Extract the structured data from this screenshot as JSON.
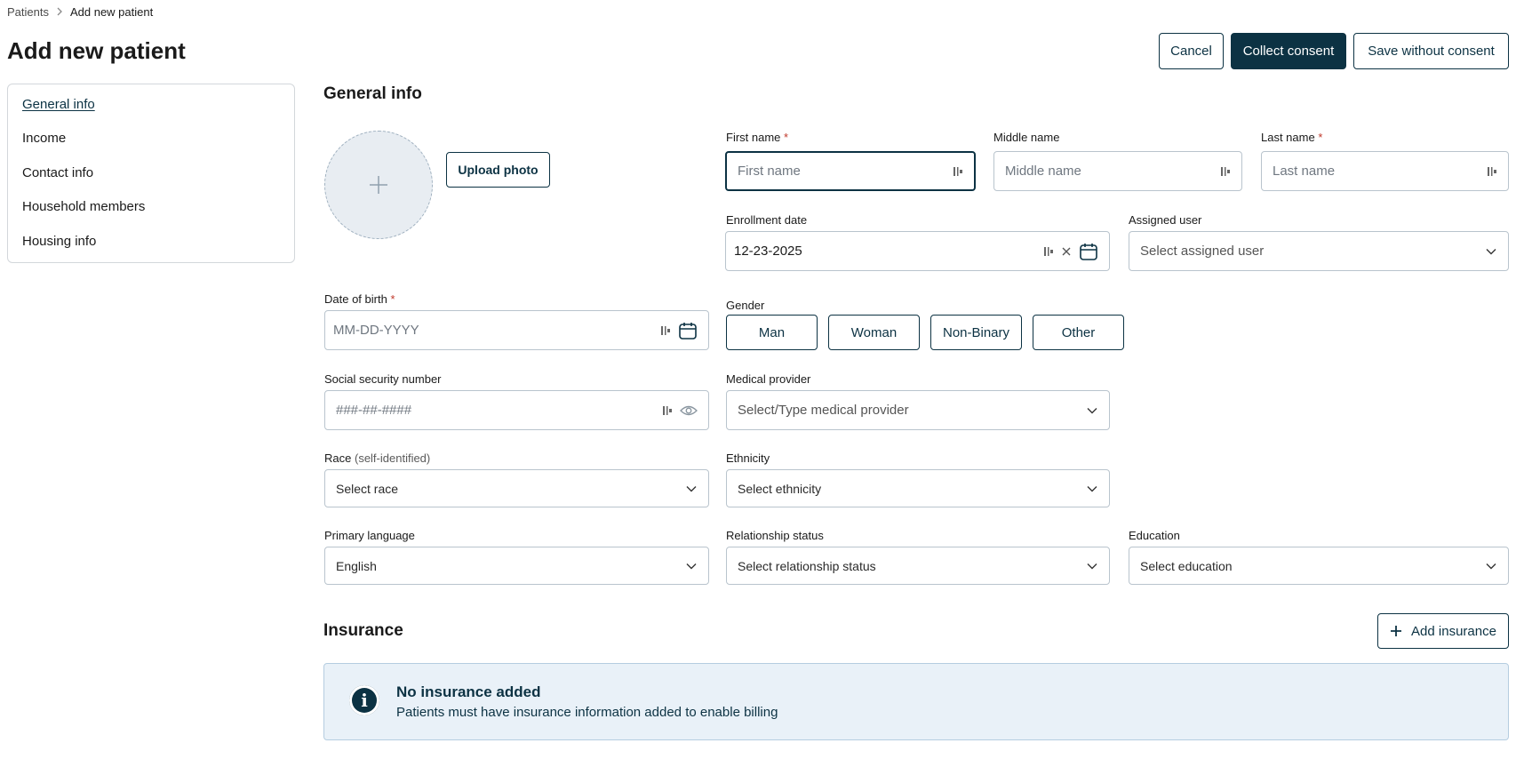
{
  "breadcrumb": {
    "parent": "Patients",
    "current": "Add new patient"
  },
  "page": {
    "title": "Add new patient"
  },
  "actions": {
    "cancel": "Cancel",
    "collect_consent": "Collect consent",
    "save_without_consent": "Save without consent"
  },
  "sidebar": {
    "items": [
      {
        "label": "General info",
        "active": true
      },
      {
        "label": "Income"
      },
      {
        "label": "Contact info"
      },
      {
        "label": "Household members"
      },
      {
        "label": "Housing info"
      }
    ]
  },
  "general": {
    "title": "General info",
    "upload_photo": "Upload photo",
    "first_name": {
      "label": "First name",
      "required": "*",
      "placeholder": "First name"
    },
    "middle_name": {
      "label": "Middle name",
      "placeholder": "Middle name"
    },
    "last_name": {
      "label": "Last name",
      "required": "*",
      "placeholder": "Last name"
    },
    "enrollment_date": {
      "label": "Enrollment date",
      "value": "12-23-2025"
    },
    "assigned_user": {
      "label": "Assigned user",
      "placeholder": "Select assigned user"
    },
    "dob": {
      "label": "Date of birth",
      "required": "*",
      "placeholder": "MM-DD-YYYY"
    },
    "gender": {
      "label": "Gender",
      "options": [
        "Man",
        "Woman",
        "Non-Binary",
        "Other"
      ]
    },
    "ssn": {
      "label": "Social security number",
      "placeholder": "###-##-####"
    },
    "medical_provider": {
      "label": "Medical provider",
      "placeholder": "Select/Type medical provider"
    },
    "race": {
      "label": "Race",
      "hint": "(self-identified)",
      "placeholder": "Select race"
    },
    "ethnicity": {
      "label": "Ethnicity",
      "placeholder": "Select ethnicity"
    },
    "primary_language": {
      "label": "Primary language",
      "value": "English"
    },
    "relationship_status": {
      "label": "Relationship status",
      "placeholder": "Select relationship status"
    },
    "education": {
      "label": "Education",
      "placeholder": "Select education"
    }
  },
  "insurance": {
    "title": "Insurance",
    "add_button": "Add insurance",
    "empty_title": "No insurance added",
    "empty_text": "Patients must have insurance information added to enable billing"
  },
  "colors": {
    "primary": "#0c3243",
    "required": "#c0392b",
    "banner_bg": "#e9f1f8",
    "border": "#b9c4cd"
  },
  "icons": [
    "chevron-right-icon",
    "plus-icon",
    "autofill-icon",
    "clear-icon",
    "calendar-icon",
    "chevron-down-icon",
    "eye-icon",
    "info-icon"
  ]
}
